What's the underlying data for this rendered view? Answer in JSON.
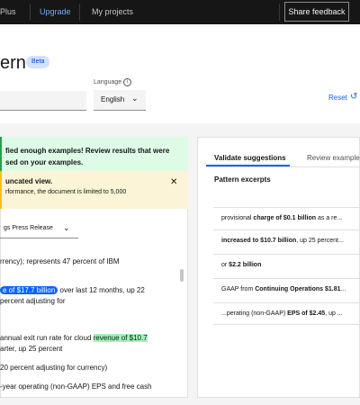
{
  "topbar": {
    "plan": "Plus",
    "upgrade": "Upgrade",
    "my_projects": "My projects",
    "share_feedback": "Share feedback"
  },
  "header": {
    "title": "ern",
    "badge": "Beta",
    "language_label": "Language",
    "language_value": "English",
    "reset": "Reset"
  },
  "notifications": {
    "green_line1": "fied enough examples! Review results that were",
    "green_line2": "sed on your examples.",
    "yellow_title": "uncated view.",
    "yellow_body": "rformance, the document is limited to 5,000"
  },
  "document": {
    "selector": "gs Press Release",
    "lines": [
      {
        "pre": "rrency); represents 47 percent of IBM",
        "hl": "",
        "post": "",
        "style": ""
      },
      {
        "pre": "",
        "hl": "e of $17.7 billion",
        "post": " over last 12 months, up 22",
        "style": "blue"
      },
      {
        "pre": "percent adjusting for",
        "hl": "",
        "post": "",
        "style": ""
      },
      {
        "pre": "annual exit run rate for cloud ",
        "hl": "revenue of $10.7",
        "post": "",
        "style": "green"
      },
      {
        "pre": "arter, up 25 percent",
        "hl": "",
        "post": "",
        "style": ""
      },
      {
        "pre": " 20 percent adjusting for currency)",
        "hl": "",
        "post": "",
        "style": ""
      },
      {
        "pre": "-year operating (non-GAAP) EPS and free cash",
        "hl": "",
        "post": "",
        "style": ""
      }
    ]
  },
  "right_panel": {
    "tabs": [
      "Validate suggestions",
      "Review examples"
    ],
    "section_title": "Pattern excerpts",
    "excerpts": [
      {
        "pre": "provisional ",
        "bold": "charge of $0.1 billion",
        "post": " as a re..."
      },
      {
        "pre": "",
        "bold": "increased to $10.7 billion",
        "post": ", up 25 percent..."
      },
      {
        "pre": "or ",
        "bold": "$2.2 billion",
        "post": ""
      },
      {
        "pre": "GAAP from ",
        "bold": "Continuing Operations $1.81",
        "post": "..."
      },
      {
        "pre": "...perating (non-GAAP) ",
        "bold": "EPS of $2.45",
        "post": ", up ..."
      }
    ]
  },
  "colors": {
    "accent": "#0f62fe",
    "topbar_bg": "#161616",
    "success_bg": "#defbe6",
    "warning_bg": "#fcf4d6",
    "highlight_green": "#a7f0ba"
  },
  "icons": [
    "info-icon",
    "reset-icon",
    "close-icon",
    "chevron-down-icon"
  ]
}
